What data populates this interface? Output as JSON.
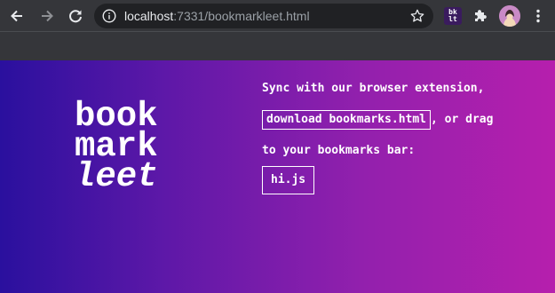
{
  "browser": {
    "url_host": "localhost",
    "url_rest": ":7331/bookmarkleet.html",
    "extension_badge": [
      "bk",
      "lt"
    ]
  },
  "page": {
    "logo": [
      "book",
      "mark",
      "leet"
    ],
    "instructions": {
      "line1": "Sync with our browser extension,",
      "download_link": "download bookmarks.html",
      "after_link": ", or drag",
      "line3": "to your bookmarks bar:"
    },
    "bookmarklet": "hi.js"
  },
  "colors": {
    "gradient": [
      "#2a109e",
      "#5e18a8",
      "#9220ad",
      "#b61fad"
    ],
    "chrome_bg": "#35363a",
    "omnibox_bg": "#202124"
  }
}
